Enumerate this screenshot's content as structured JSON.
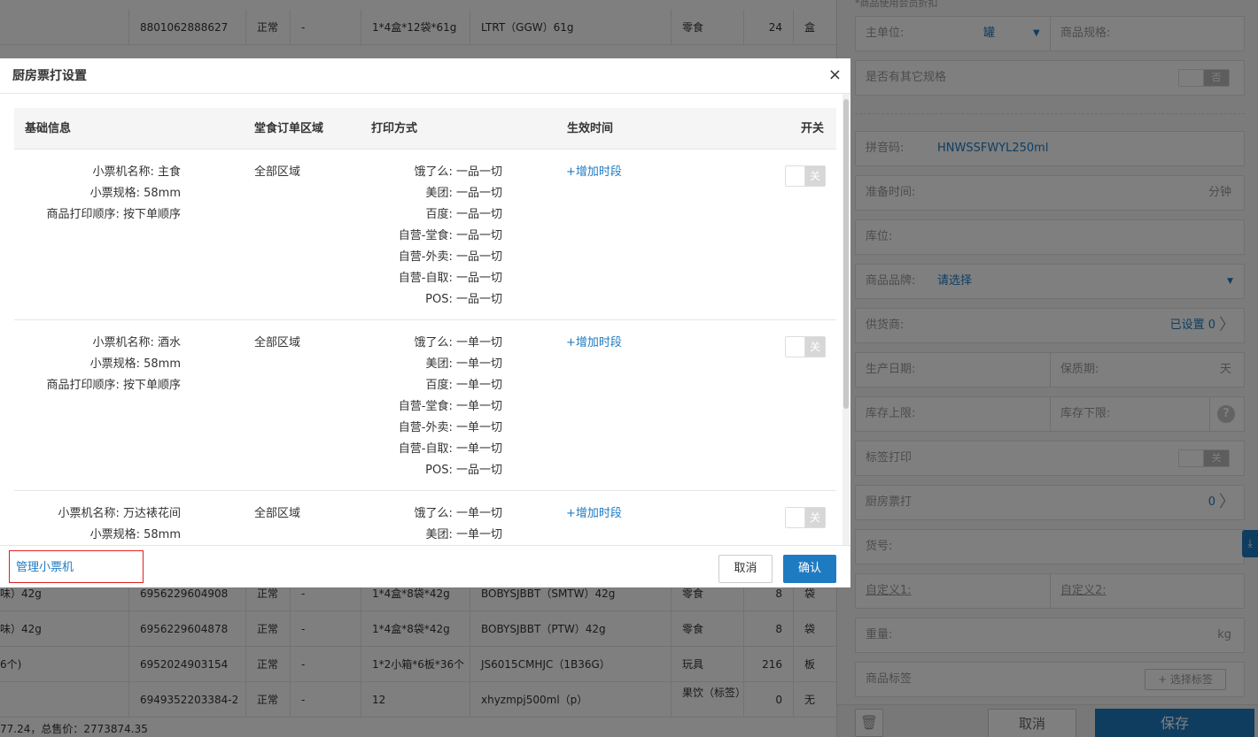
{
  "table": {
    "top_row": {
      "code": "8801062888627",
      "status": "正常",
      "dash": "-",
      "spec": "1*4盒*12袋*61g",
      "name": "LTRT（GGW）61g",
      "cat": "零食",
      "qty": "24",
      "unit": "盒"
    },
    "rows": [
      {
        "prefix": "味）42g",
        "code": "6956229604908",
        "status": "正常",
        "dash": "-",
        "spec": "1*4盒*8袋*42g",
        "name": "BOBYSJBBT（SMTW）42g",
        "cat": "零食",
        "qty": "8",
        "unit": "袋"
      },
      {
        "prefix": "味）42g",
        "code": "6956229604878",
        "status": "正常",
        "dash": "-",
        "spec": "1*4盒*8袋*42g",
        "name": "BOBYSJBBT（PTW）42g",
        "cat": "零食",
        "qty": "8",
        "unit": "袋"
      },
      {
        "prefix": "6个)",
        "code": "6952024903154",
        "status": "正常",
        "dash": "-",
        "spec": "1*2小箱*6板*36个",
        "name": "JS6015CMHJC（1B36G）",
        "cat": "玩具",
        "qty": "216",
        "unit": "板"
      },
      {
        "prefix": "",
        "code": "6949352203384-2",
        "status": "正常",
        "dash": "-",
        "spec": "12",
        "name": "xhyzmpj500ml（p）",
        "cat": "果饮（标签）",
        "qty": "0",
        "unit": "无"
      }
    ],
    "footer": "77.24，总售价：2773874.35"
  },
  "right_panel": {
    "top_text": "*商品使用会员折扣",
    "main_unit_label": "主单位:",
    "main_unit_value": "罐",
    "spec_label": "商品规格:",
    "other_spec_label": "是否有其它规格",
    "other_spec_toggle": "否",
    "pinyin_label": "拼音码:",
    "pinyin_value": "HNWSSFWYL250ml",
    "prep_label": "准备时间:",
    "prep_unit": "分钟",
    "location_label": "库位:",
    "brand_label": "商品品牌:",
    "brand_value": "请选择",
    "supplier_label": "供货商:",
    "supplier_value": "已设置 0",
    "prod_date_label": "生产日期:",
    "shelf_label": "保质期:",
    "shelf_unit": "天",
    "stock_upper_label": "库存上限:",
    "stock_lower_label": "库存下限:",
    "label_print_label": "标签打印",
    "label_print_toggle": "关",
    "kitchen_label": "厨房票打",
    "kitchen_value": "0",
    "item_no_label": "货号:",
    "custom1_label": "自定义1:",
    "custom2_label": "自定义2:",
    "weight_label": "重量:",
    "weight_unit": "kg",
    "tag_label": "商品标签",
    "tag_button": "+ 选择标签",
    "cancel": "取消",
    "save": "保存"
  },
  "modal": {
    "title": "厨房票打设置",
    "close": "×",
    "headers": {
      "info": "基础信息",
      "area": "堂食订单区域",
      "print": "打印方式",
      "time": "生效时间",
      "switch": "开关"
    },
    "printers": [
      {
        "info": [
          "小票机名称: 主食",
          "小票规格: 58mm",
          "商品打印顺序: 按下单顺序"
        ],
        "area": "全部区域",
        "print": [
          "饿了么: 一品一切",
          "美团: 一品一切",
          "百度: 一品一切",
          "自营-堂食: 一品一切",
          "自营-外卖: 一品一切",
          "自营-自取: 一品一切",
          "POS: 一品一切"
        ],
        "add": "+增加时段",
        "toggle": "关"
      },
      {
        "info": [
          "小票机名称: 酒水",
          "小票规格: 58mm",
          "商品打印顺序: 按下单顺序"
        ],
        "area": "全部区域",
        "print": [
          "饿了么: 一单一切",
          "美团: 一单一切",
          "百度: 一单一切",
          "自营-堂食: 一单一切",
          "自营-外卖: 一单一切",
          "自营-自取: 一单一切",
          "POS: 一品一切"
        ],
        "add": "+增加时段",
        "toggle": "关"
      },
      {
        "info": [
          "小票机名称: 万达裱花间",
          "小票规格: 58mm"
        ],
        "area": "全部区域",
        "print": [
          "饿了么: 一单一切",
          "美团: 一单一切"
        ],
        "add": "+增加时段",
        "toggle": "关"
      }
    ],
    "manage": "管理小票机",
    "cancel": "取消",
    "confirm": "确认"
  }
}
